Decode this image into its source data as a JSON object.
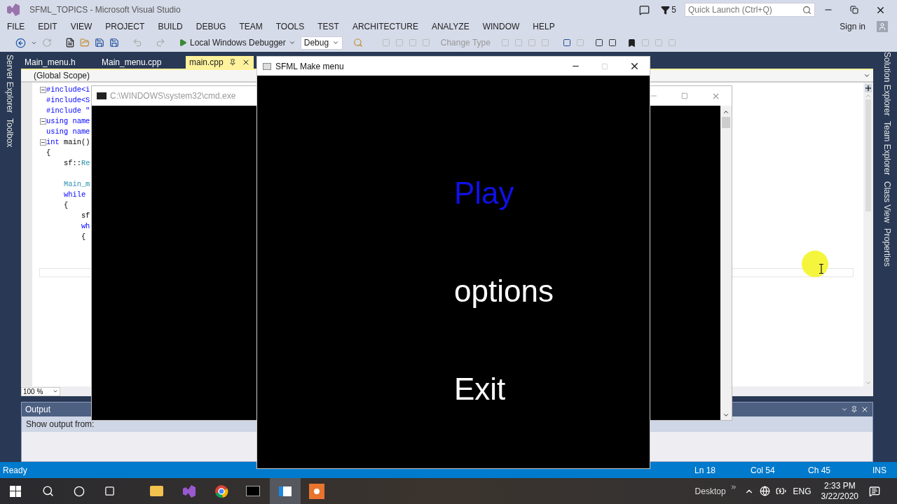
{
  "ide": {
    "title": "SFML_TOPICS - Microsoft Visual Studio",
    "notification_count": "5",
    "quick_launch": {
      "placeholder": "Quick Launch (Ctrl+Q)"
    },
    "menu": [
      "FILE",
      "EDIT",
      "VIEW",
      "PROJECT",
      "BUILD",
      "DEBUG",
      "TEAM",
      "TOOLS",
      "TEST",
      "ARCHITECTURE",
      "ANALYZE",
      "WINDOW",
      "HELP"
    ],
    "sign_in": "Sign in",
    "toolbar": {
      "debugger": "Local Windows Debugger",
      "configuration": "Debug",
      "change_type": "Change Type"
    },
    "left_tabs": [
      "Server Explorer",
      "Toolbox"
    ],
    "right_tabs": [
      "Solution Explorer",
      "Team Explorer",
      "Class View",
      "Properties"
    ],
    "doc_tabs": [
      {
        "label": "Main_menu.h",
        "selected": false
      },
      {
        "label": "Main_menu.cpp",
        "selected": false
      },
      {
        "label": "main.cpp",
        "selected": true
      }
    ],
    "scope": "(Global Scope)",
    "code": [
      {
        "kind": "line",
        "fold": true,
        "tokens": [
          {
            "text": "#include<i",
            "kind": "keyword"
          }
        ]
      },
      {
        "kind": "line",
        "fold": false,
        "tokens": [
          {
            "text": "#include<S",
            "kind": "keyword"
          }
        ]
      },
      {
        "kind": "line",
        "fold": false,
        "tokens": [
          {
            "text": "#include \"",
            "kind": "keyword"
          }
        ]
      },
      {
        "kind": "line",
        "fold": true,
        "tokens": [
          {
            "text": "using name",
            "kind": "keyword"
          }
        ]
      },
      {
        "kind": "line",
        "fold": false,
        "tokens": [
          {
            "text": "using name",
            "kind": "keyword"
          }
        ]
      },
      {
        "kind": "line",
        "fold": true,
        "tokens": [
          {
            "text": "int",
            "kind": "keyword"
          },
          {
            "text": " main()",
            "kind": "plain"
          }
        ]
      },
      {
        "kind": "line",
        "fold": false,
        "tokens": [
          {
            "text": "{",
            "kind": "plain"
          }
        ]
      },
      {
        "kind": "line",
        "fold": false,
        "tokens": [
          {
            "text": "    sf::",
            "kind": "plain"
          },
          {
            "text": "Re",
            "kind": "type"
          }
        ]
      },
      {
        "kind": "blank"
      },
      {
        "kind": "line",
        "fold": false,
        "tokens": [
          {
            "text": "    Main_m",
            "kind": "type"
          }
        ]
      },
      {
        "kind": "line",
        "fold": false,
        "tokens": [
          {
            "text": "    while",
            "kind": "keyword"
          }
        ]
      },
      {
        "kind": "line",
        "fold": false,
        "tokens": [
          {
            "text": "    {",
            "kind": "plain"
          }
        ]
      },
      {
        "kind": "line",
        "fold": false,
        "tokens": [
          {
            "text": "        sf",
            "kind": "plain"
          }
        ]
      },
      {
        "kind": "line",
        "fold": false,
        "tokens": [
          {
            "text": "        wh",
            "kind": "keyword"
          }
        ]
      },
      {
        "kind": "line",
        "fold": false,
        "tokens": [
          {
            "text": "        {",
            "kind": "plain"
          }
        ]
      }
    ],
    "zoom": "100 %",
    "output": {
      "title": "Output",
      "show_from": "Show output from:"
    }
  },
  "status": {
    "ready": "Ready",
    "line": "Ln 18",
    "col": "Col 54",
    "ch": "Ch 45",
    "mode": "INS"
  },
  "console": {
    "title": "C:\\WINDOWS\\system32\\cmd.exe"
  },
  "game": {
    "title": "SFML Make menu",
    "items": [
      {
        "label": "Play",
        "selected": true
      },
      {
        "label": "options",
        "selected": false
      },
      {
        "label": "Exit",
        "selected": false
      }
    ]
  },
  "taskbar": {
    "desktop": "Desktop",
    "language": "ENG",
    "time": "2:33 PM",
    "date": "3/22/2020"
  }
}
